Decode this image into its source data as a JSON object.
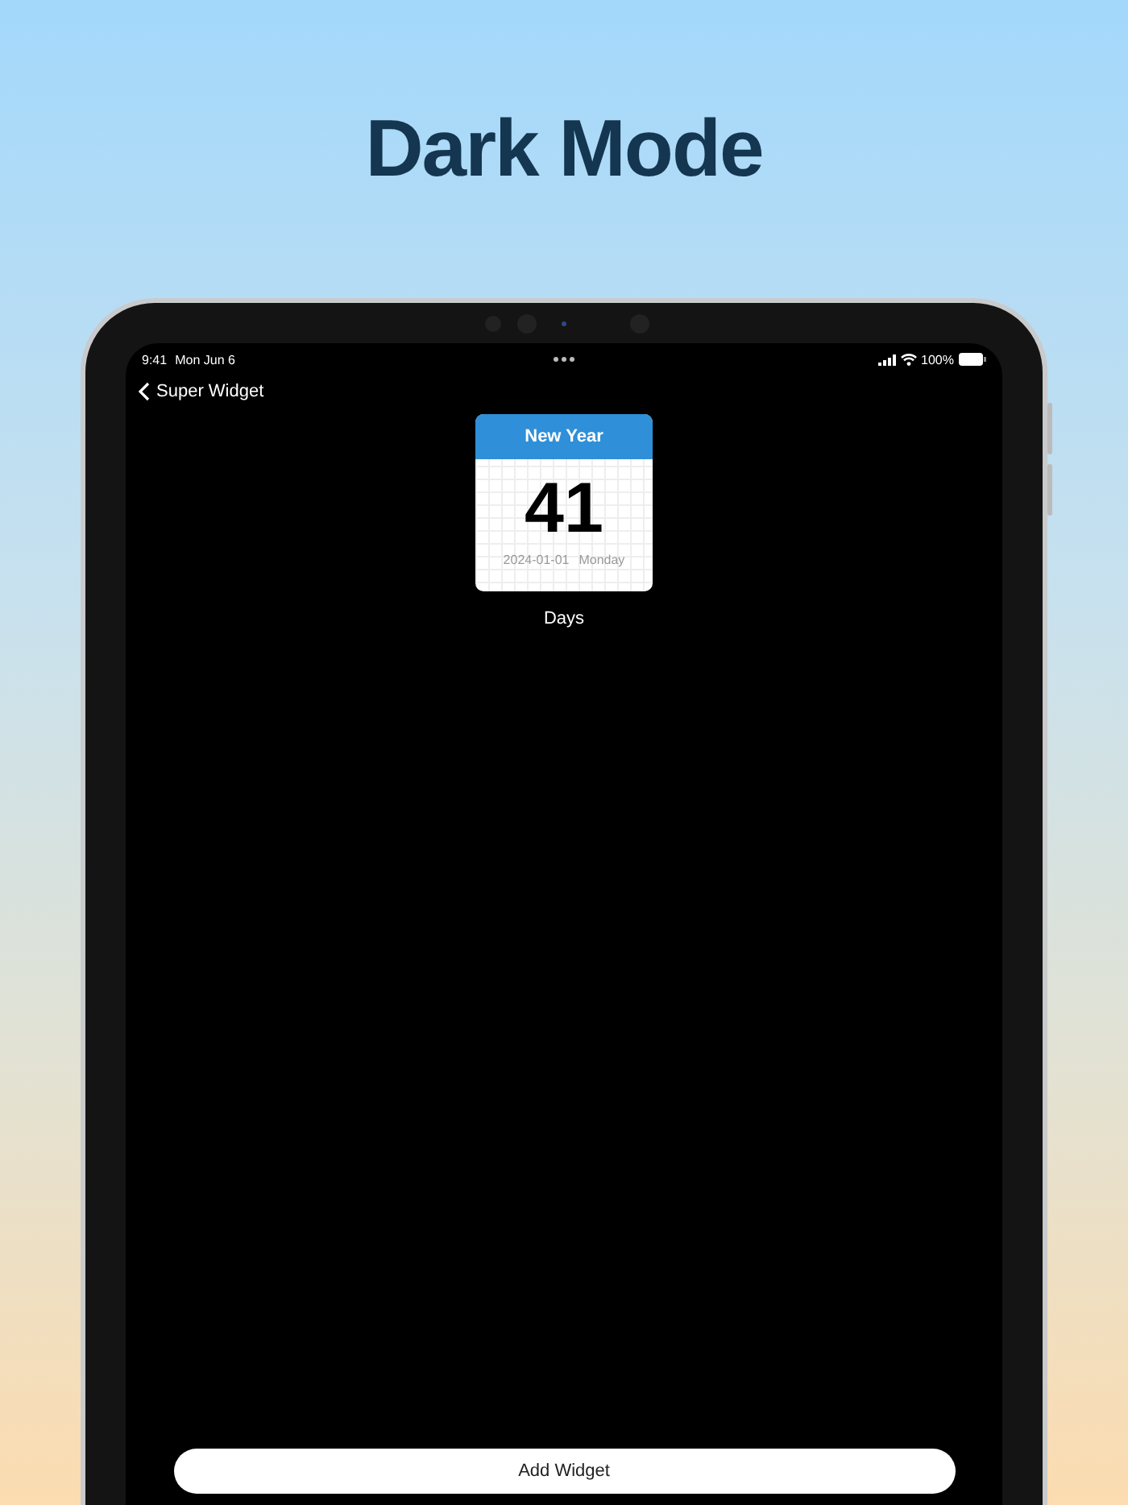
{
  "headline": "Dark Mode",
  "status_bar": {
    "time": "9:41",
    "date": "Mon Jun 6",
    "battery": "100%"
  },
  "nav": {
    "back_label": "Super Widget"
  },
  "widget": {
    "title": "New Year",
    "count": "41",
    "date": "2024-01-01",
    "weekday": "Monday",
    "caption": "Days"
  },
  "button": {
    "label": "Add Widget"
  }
}
